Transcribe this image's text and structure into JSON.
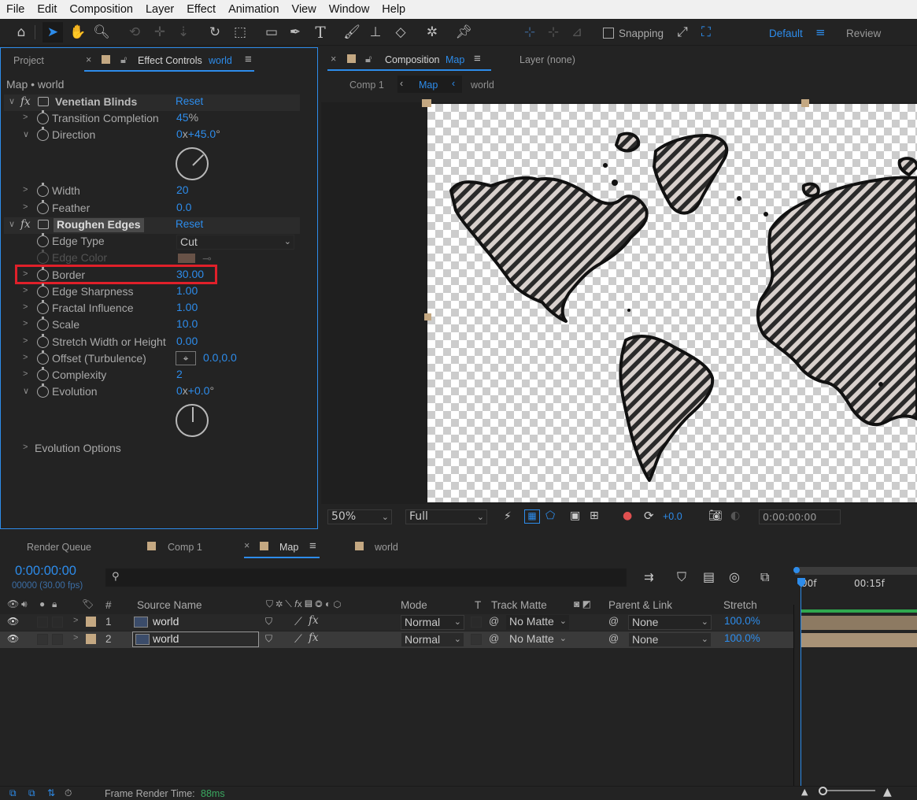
{
  "menu": [
    "File",
    "Edit",
    "Composition",
    "Layer",
    "Effect",
    "Animation",
    "View",
    "Window",
    "Help"
  ],
  "toolbar": {
    "snapping_label": "Snapping",
    "workspace": "Default",
    "review": "Review"
  },
  "left_panel": {
    "tab_project": "Project",
    "tab_effect_controls": "Effect Controls",
    "tab_effect_controls_layer": "world",
    "breadcrumb": "Map • world",
    "effect1": {
      "name": "Venetian Blinds",
      "reset": "Reset",
      "props": [
        {
          "label": "Transition Completion",
          "value": "45",
          "unit": "%"
        },
        {
          "label": "Direction",
          "value": "0",
          "value2": "x+45.0",
          "unit": "°"
        },
        {
          "label": "Width",
          "value": "20"
        },
        {
          "label": "Feather",
          "value": "0.0"
        }
      ]
    },
    "effect2": {
      "name": "Roughen Edges",
      "reset": "Reset",
      "props": [
        {
          "label": "Edge Type",
          "value": "Cut"
        },
        {
          "label": "Edge Color",
          "value": ""
        },
        {
          "label": "Border",
          "value": "30.00"
        },
        {
          "label": "Edge Sharpness",
          "value": "1.00"
        },
        {
          "label": "Fractal Influence",
          "value": "1.00"
        },
        {
          "label": "Scale",
          "value": "10.0"
        },
        {
          "label": "Stretch Width or Height",
          "value": "0.00"
        },
        {
          "label": "Offset (Turbulence)",
          "value": "0.0,0.0"
        },
        {
          "label": "Complexity",
          "value": "2"
        },
        {
          "label": "Evolution",
          "value": "0",
          "value2": "x+0.0",
          "unit": "°"
        }
      ],
      "evolution_options": "Evolution Options"
    },
    "fx": "fx"
  },
  "comp_panel": {
    "tab_composition": "Composition",
    "tab_composition_name": "Map",
    "tab_layer": "Layer (none)",
    "crumbs": [
      "Comp 1",
      "Map",
      "world"
    ],
    "zoom": "50%",
    "resolution": "Full",
    "exposure": "+0.0",
    "timecode": "0:00:00:00"
  },
  "timeline": {
    "tabs": [
      "Render Queue",
      "Comp 1",
      "Map",
      "world"
    ],
    "timecode": "0:00:00:00",
    "fps": "00000 (30.00 fps)",
    "search_placeholder": "",
    "ruler": [
      "00f",
      "00:15f"
    ],
    "columns": {
      "source": "Source Name",
      "num": "#",
      "mode": "Mode",
      "t": "T",
      "track": "Track Matte",
      "parent": "Parent & Link",
      "stretch": "Stretch"
    },
    "layers": [
      {
        "num": "1",
        "name": "world",
        "mode": "Normal",
        "matte": "No Matte",
        "parent": "None",
        "stretch": "100.0%"
      },
      {
        "num": "2",
        "name": "world",
        "mode": "Normal",
        "matte": "No Matte",
        "parent": "None",
        "stretch": "100.0%"
      }
    ]
  },
  "status": {
    "label": "Frame Render Time:",
    "value": "88ms"
  },
  "colors": {
    "accent": "#2d8ceb",
    "label_tan": "#c4a882",
    "highlight": "#e0202a"
  }
}
